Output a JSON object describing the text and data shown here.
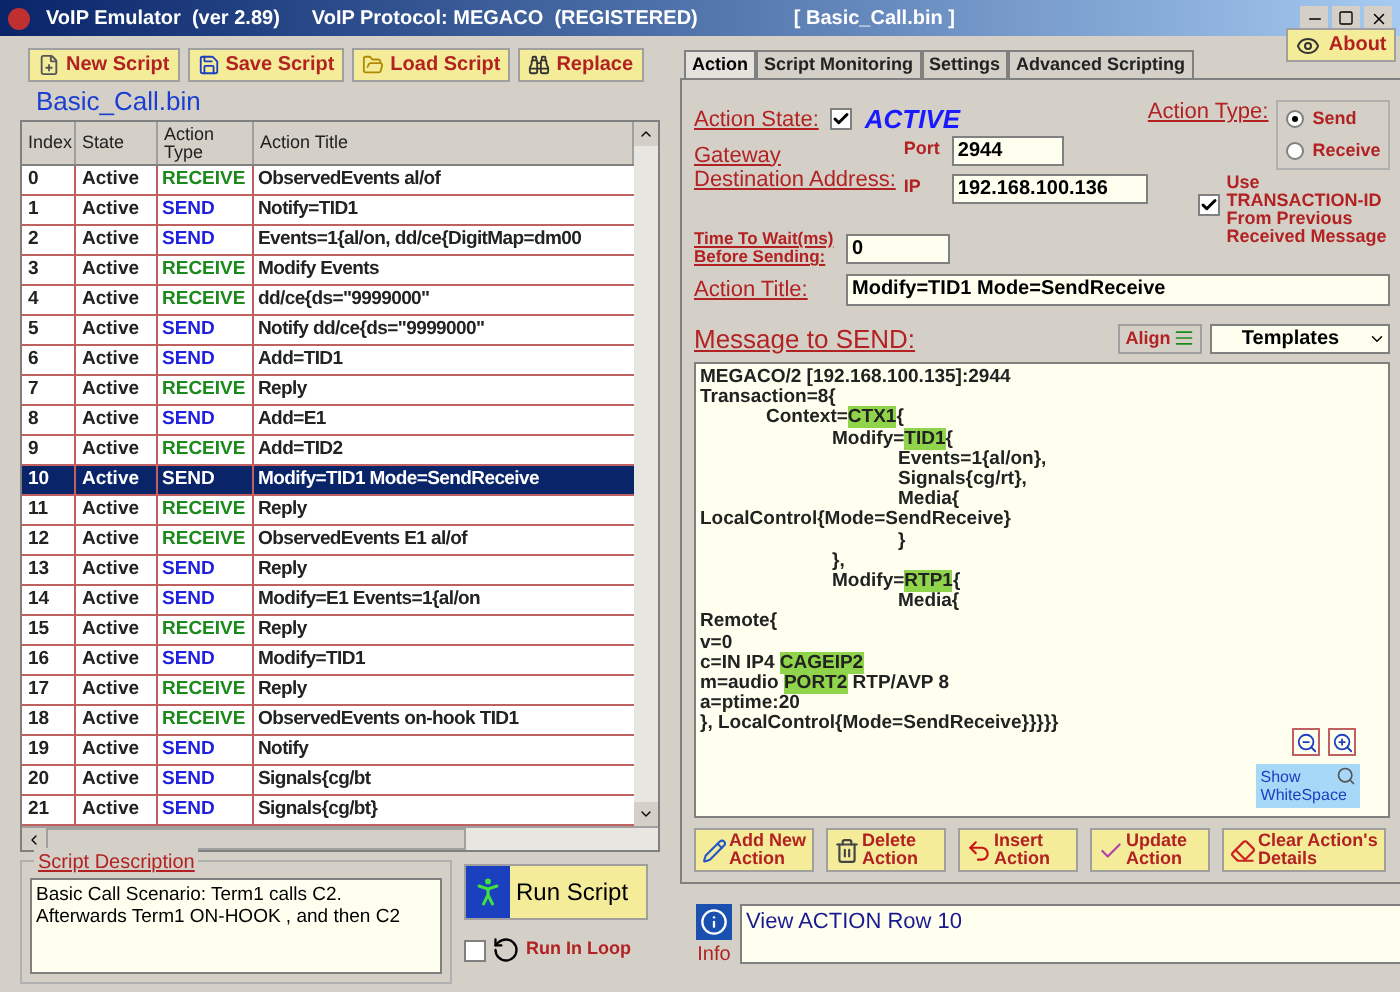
{
  "window": {
    "title": "VoIP Emulator  (ver 2.89)",
    "protocol": "VoIP Protocol: MEGACO  (REGISTERED)",
    "file": "[ Basic_Call.bin ]"
  },
  "toolbar": [
    {
      "label": "New Script",
      "kind": "new"
    },
    {
      "label": "Save Script",
      "kind": "save"
    },
    {
      "label": "Load Script",
      "kind": "load"
    },
    {
      "label": "Replace",
      "kind": "replace"
    }
  ],
  "script_name": "Basic_Call.bin",
  "table": {
    "columns": [
      "Index",
      "State",
      "Action Type",
      "Action Title"
    ],
    "rows": [
      {
        "index": "0",
        "state": "Active",
        "type": "RECEIVE",
        "kind": "receive",
        "title": "ObservedEvents al/of",
        "selected": false
      },
      {
        "index": "1",
        "state": "Active",
        "type": "SEND",
        "kind": "send",
        "title": "Notify=TID1",
        "selected": false
      },
      {
        "index": "2",
        "state": "Active",
        "type": "SEND",
        "kind": "send",
        "title": "Events=1{al/on, dd/ce{DigitMap=dm00",
        "selected": false
      },
      {
        "index": "3",
        "state": "Active",
        "type": "RECEIVE",
        "kind": "receive",
        "title": "Modify Events",
        "selected": false
      },
      {
        "index": "4",
        "state": "Active",
        "type": "RECEIVE",
        "kind": "receive",
        "title": "dd/ce{ds=\"9999000\"",
        "selected": false
      },
      {
        "index": "5",
        "state": "Active",
        "type": "SEND",
        "kind": "send",
        "title": "Notify dd/ce{ds=\"9999000\"",
        "selected": false
      },
      {
        "index": "6",
        "state": "Active",
        "type": "SEND",
        "kind": "send",
        "title": "Add=TID1",
        "selected": false
      },
      {
        "index": "7",
        "state": "Active",
        "type": "RECEIVE",
        "kind": "receive",
        "title": "Reply",
        "selected": false
      },
      {
        "index": "8",
        "state": "Active",
        "type": "SEND",
        "kind": "send",
        "title": "Add=E1",
        "selected": false
      },
      {
        "index": "9",
        "state": "Active",
        "type": "RECEIVE",
        "kind": "receive",
        "title": "Add=TID2",
        "selected": false
      },
      {
        "index": "10",
        "state": "Active",
        "type": "SEND",
        "kind": "send",
        "title": "Modify=TID1 Mode=SendReceive",
        "selected": true
      },
      {
        "index": "11",
        "state": "Active",
        "type": "RECEIVE",
        "kind": "receive",
        "title": "Reply",
        "selected": false
      },
      {
        "index": "12",
        "state": "Active",
        "type": "RECEIVE",
        "kind": "receive",
        "title": "ObservedEvents E1 al/of",
        "selected": false
      },
      {
        "index": "13",
        "state": "Active",
        "type": "SEND",
        "kind": "send",
        "title": "Reply",
        "selected": false
      },
      {
        "index": "14",
        "state": "Active",
        "type": "SEND",
        "kind": "send",
        "title": "Modify=E1  Events=1{al/on",
        "selected": false
      },
      {
        "index": "15",
        "state": "Active",
        "type": "RECEIVE",
        "kind": "receive",
        "title": "Reply",
        "selected": false
      },
      {
        "index": "16",
        "state": "Active",
        "type": "SEND",
        "kind": "send",
        "title": "Modify=TID1",
        "selected": false
      },
      {
        "index": "17",
        "state": "Active",
        "type": "RECEIVE",
        "kind": "receive",
        "title": "Reply",
        "selected": false
      },
      {
        "index": "18",
        "state": "Active",
        "type": "RECEIVE",
        "kind": "receive",
        "title": "ObservedEvents on-hook TID1",
        "selected": false
      },
      {
        "index": "19",
        "state": "Active",
        "type": "SEND",
        "kind": "send",
        "title": "Notify",
        "selected": false
      },
      {
        "index": "20",
        "state": "Active",
        "type": "SEND",
        "kind": "send",
        "title": "Signals{cg/bt",
        "selected": false
      },
      {
        "index": "21",
        "state": "Active",
        "type": "SEND",
        "kind": "send",
        "title": "Signals{cg/bt}",
        "selected": false
      }
    ]
  },
  "description": {
    "label": "Script Description",
    "lines": [
      "Basic Call Scenario: Term1 calls C2.",
      "Afterwards Term1 ON-HOOK , and then C2"
    ]
  },
  "run_button": "Run Script",
  "run_in_loop": {
    "label": "Run In Loop",
    "checked": false
  },
  "about": "About",
  "tabs": [
    {
      "label": "Action",
      "selected": true
    },
    {
      "label": "Script Monitoring",
      "selected": false
    },
    {
      "label": "Settings",
      "selected": false
    },
    {
      "label": "Advanced Scripting",
      "selected": false
    }
  ],
  "action": {
    "state_label": "Action State:",
    "state_checked": true,
    "state_value": "ACTIVE",
    "type_label": "Action Type:",
    "type_options": [
      {
        "label": "Send",
        "selected": true
      },
      {
        "label": "Receive",
        "selected": false
      }
    ],
    "gateway_label": [
      "Gateway",
      "Destination Address:"
    ],
    "port_label": "Port",
    "port": "2944",
    "ip_label": "IP",
    "ip": "192.168.100.136",
    "transaction": {
      "lines": [
        "Use",
        "TRANSACTION-ID",
        "From Previous",
        "Received Message"
      ],
      "checked": true
    },
    "wait_label": [
      "Time To Wait(ms)",
      "Before Sending:"
    ],
    "wait": "0",
    "title_label": "Action Title:",
    "title": "Modify=TID1 Mode=SendReceive"
  },
  "message": {
    "label": "Message to SEND:",
    "align": "Align",
    "templates": "Templates",
    "show_whitespace": "Show WhiteSpace",
    "lines": [
      [
        {
          "text": "MEGACO/2 [192.168.100.135]:2944",
          "highlight": false
        }
      ],
      [
        {
          "text": "Transaction=8{",
          "highlight": false
        }
      ],
      [
        {
          "text": "\tContext=",
          "highlight": false
        },
        {
          "text": "CTX1",
          "highlight": true
        },
        {
          "text": "{",
          "highlight": false
        }
      ],
      [
        {
          "text": "\t\tModify=",
          "highlight": false
        },
        {
          "text": "TID1",
          "highlight": true
        },
        {
          "text": "{",
          "highlight": false
        }
      ],
      [
        {
          "text": "\t\t\tEvents=1{al/on},",
          "highlight": false
        }
      ],
      [
        {
          "text": "\t\t\tSignals{cg/rt},",
          "highlight": false
        }
      ],
      [
        {
          "text": "\t\t\tMedia{",
          "highlight": false
        }
      ],
      [
        {
          "text": "LocalControl{Mode=SendReceive}",
          "highlight": false
        }
      ],
      [
        {
          "text": "\t\t\t}",
          "highlight": false
        }
      ],
      [
        {
          "text": "\t\t},",
          "highlight": false
        }
      ],
      [
        {
          "text": "\t\tModify=",
          "highlight": false
        },
        {
          "text": "RTP1",
          "highlight": true
        },
        {
          "text": "{",
          "highlight": false
        }
      ],
      [
        {
          "text": "\t\t\tMedia{",
          "highlight": false
        }
      ],
      [
        {
          "text": "Remote{",
          "highlight": false
        }
      ],
      [
        {
          "text": "v=0",
          "highlight": false
        }
      ],
      [
        {
          "text": "c=IN IP4 ",
          "highlight": false
        },
        {
          "text": "CAGEIP2",
          "highlight": true
        }
      ],
      [
        {
          "text": "m=audio ",
          "highlight": false
        },
        {
          "text": "PORT2",
          "highlight": true
        },
        {
          "text": " RTP/AVP 8",
          "highlight": false
        }
      ],
      [
        {
          "text": "a=ptime:20",
          "highlight": false
        }
      ],
      [
        {
          "text": "}, LocalControl{Mode=SendReceive}}}}}",
          "highlight": false
        }
      ]
    ]
  },
  "buttons": [
    {
      "lines": [
        "Add New",
        "Action"
      ],
      "kind": "add"
    },
    {
      "lines": [
        "Delete",
        "Action"
      ],
      "kind": "delete"
    },
    {
      "lines": [
        "Insert",
        "Action"
      ],
      "kind": "insert"
    },
    {
      "lines": [
        "Update",
        "Action"
      ],
      "kind": "update"
    },
    {
      "lines": [
        "Clear Action's",
        "Details"
      ],
      "kind": "clear"
    }
  ],
  "info": {
    "label": "Info",
    "text": "View ACTION Row 10"
  }
}
